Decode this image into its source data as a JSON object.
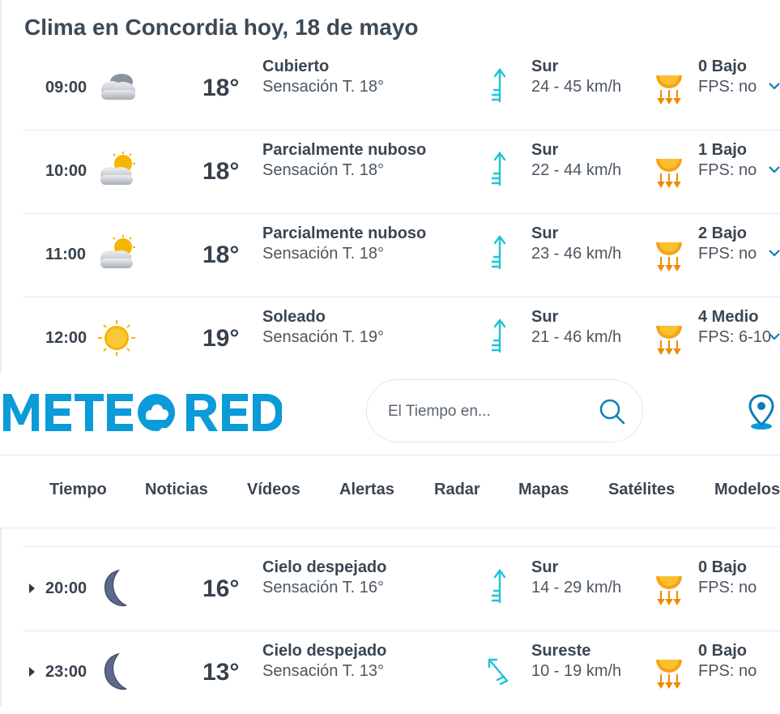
{
  "page_title": "Clima en Concordia hoy, 18 de mayo",
  "rows_top": [
    {
      "time": "09:00",
      "icon": "cloudy-icon",
      "temp": "18°",
      "desc": "Cubierto",
      "feels": "Sensación T. 18°",
      "wind_dir": "Sur",
      "wind_speed": "24 - 45 km/h",
      "uv": "0 Bajo",
      "fps": "FPS: no"
    },
    {
      "time": "10:00",
      "icon": "partly-cloudy-icon",
      "temp": "18°",
      "desc": "Parcialmente nuboso",
      "feels": "Sensación T. 18°",
      "wind_dir": "Sur",
      "wind_speed": "22 - 44 km/h",
      "uv": "1 Bajo",
      "fps": "FPS: no"
    },
    {
      "time": "11:00",
      "icon": "partly-cloudy-icon",
      "temp": "18°",
      "desc": "Parcialmente nuboso",
      "feels": "Sensación T. 18°",
      "wind_dir": "Sur",
      "wind_speed": "23 - 46 km/h",
      "uv": "2 Bajo",
      "fps": "FPS: no"
    },
    {
      "time": "12:00",
      "icon": "sun-icon",
      "temp": "19°",
      "desc": "Soleado",
      "feels": "Sensación T. 19°",
      "wind_dir": "Sur",
      "wind_speed": "21 - 46 km/h",
      "uv": "4 Medio",
      "fps": "FPS: 6-10"
    }
  ],
  "header": {
    "logo_text": "METEORED",
    "search_placeholder": "El Tiempo en...",
    "nav": [
      "Tiempo",
      "Noticias",
      "Vídeos",
      "Alertas",
      "Radar",
      "Mapas",
      "Satélites",
      "Modelos"
    ]
  },
  "rows_bottom": [
    {
      "time": "20:00",
      "icon": "moon-icon",
      "temp": "16°",
      "desc": "Cielo despejado",
      "feels": "Sensación T. 16°",
      "wind_dir": "Sur",
      "wind_speed": "14 - 29 km/h",
      "uv": "0 Bajo",
      "fps": "FPS: no"
    },
    {
      "time": "23:00",
      "icon": "moon-icon",
      "temp": "13°",
      "desc": "Cielo despejado",
      "feels": "Sensación T. 13°",
      "wind_dir": "Sureste",
      "wind_speed": "10 - 19 km/h",
      "uv": "0 Bajo",
      "fps": "FPS: no"
    }
  ],
  "colors": {
    "brand": "#0b9bd8",
    "wind": "#1fc3d6",
    "uv": "#f08a00",
    "text": "#3a4651"
  }
}
